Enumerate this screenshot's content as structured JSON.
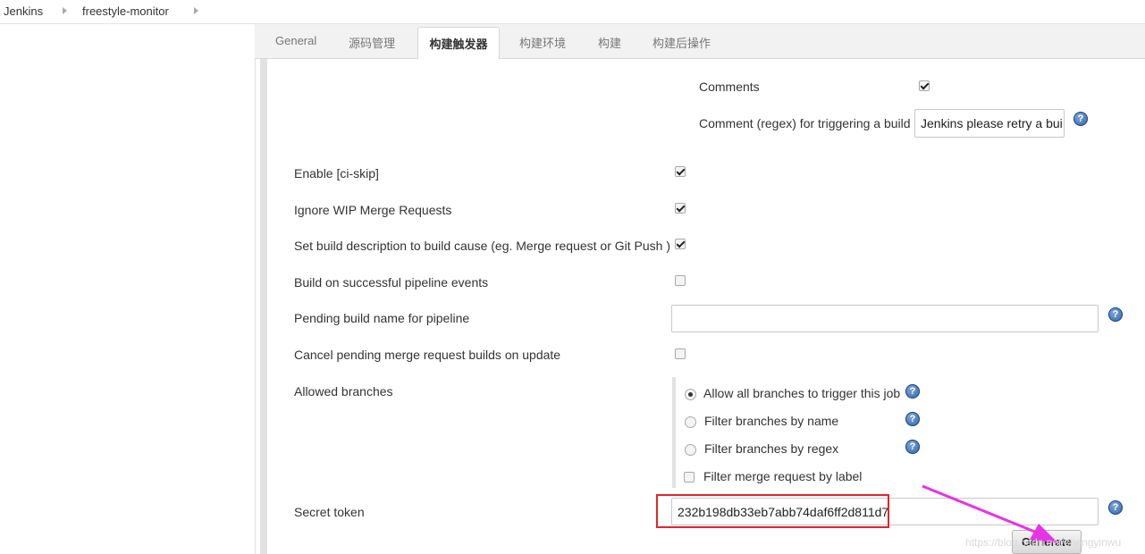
{
  "breadcrumb": {
    "items": [
      "Jenkins",
      "freestyle-monitor"
    ]
  },
  "tabs": {
    "items": [
      "General",
      "源码管理",
      "构建触发器",
      "构建环境",
      "构建",
      "构建后操作"
    ],
    "active": "构建触发器"
  },
  "form": {
    "comments_label": "Comments",
    "comments_checked": true,
    "comment_regex_label": "Comment (regex) for triggering a build",
    "comment_regex_value": "Jenkins please retry a bui",
    "ci_skip_label": "Enable [ci-skip]",
    "ci_skip_checked": true,
    "ignore_wip_label": "Ignore WIP Merge Requests",
    "ignore_wip_checked": true,
    "build_desc_label": "Set build description to build cause (eg. Merge request or Git Push )",
    "build_desc_checked": true,
    "pipeline_events_label": "Build on successful pipeline events",
    "pipeline_events_checked": false,
    "pending_name_label": "Pending build name for pipeline",
    "pending_name_value": "",
    "cancel_pending_label": "Cancel pending merge request builds on update",
    "cancel_pending_checked": false,
    "allowed_branches_label": "Allowed branches",
    "branch_options": [
      "Allow all branches to trigger this job",
      "Filter branches by name",
      "Filter branches by regex"
    ],
    "branch_selected": "Allow all branches to trigger this job",
    "filter_label_checkbox": "Filter merge request by label",
    "filter_label_checked": false,
    "secret_token_label": "Secret token",
    "secret_token_value": "232b198db33eb7abb74daf6ff2d811d7",
    "generate_button": "Generate",
    "help_symbol": "?"
  },
  "watermark": "https://blog.csdn.net/zhengyinwu",
  "colors": {
    "highlight_border": "#e3242b",
    "arrow": "#e633e6",
    "help_icon": "#2c5fa3"
  }
}
